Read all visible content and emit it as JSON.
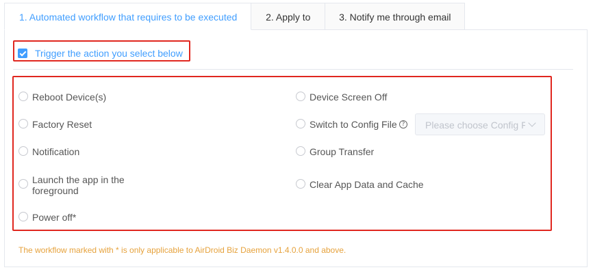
{
  "tabs": [
    {
      "label": "1. Automated workflow that requires to be executed"
    },
    {
      "label": "2. Apply to"
    },
    {
      "label": "3. Notify me through email"
    }
  ],
  "trigger": {
    "label": "Trigger the action you select below",
    "checked": true
  },
  "options": {
    "reboot": "Reboot Device(s)",
    "factory_reset": "Factory Reset",
    "notification": "Notification",
    "launch_app_line1": "Launch the app in the",
    "launch_app_line2": "foreground",
    "power_off": "Power off*",
    "screen_off": "Device Screen Off",
    "switch_config": "Switch to Config File",
    "group_transfer": "Group Transfer",
    "clear_app_data": "Clear App Data and Cache"
  },
  "config_select": {
    "placeholder": "Please choose Config File"
  },
  "footnote": "The workflow marked with * is only applicable to AirDroid Biz Daemon v1.4.0.0 and above.",
  "colors": {
    "accent": "#409eff",
    "highlight_border": "#e0261e",
    "warning": "#e6a23c"
  }
}
